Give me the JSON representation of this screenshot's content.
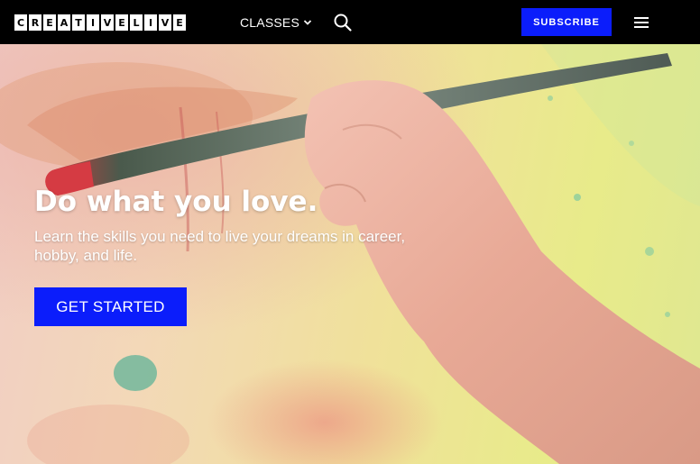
{
  "nav": {
    "logo_letters": [
      "C",
      "R",
      "E",
      "A",
      "T",
      "I",
      "V",
      "E",
      "L",
      "I",
      "V",
      "E"
    ],
    "classes_label": "CLASSES",
    "subscribe_label": "SUBSCRIBE"
  },
  "hero": {
    "headline": "Do what you love.",
    "subline": "Learn the skills you need to live your dreams in career, hobby, and life.",
    "cta_label": "GET STARTED"
  },
  "colors": {
    "nav_bg": "#000000",
    "accent": "#0b1dfb",
    "text": "#ffffff"
  },
  "icons": [
    "chevron-down-icon",
    "search-icon",
    "hamburger-menu-icon"
  ]
}
